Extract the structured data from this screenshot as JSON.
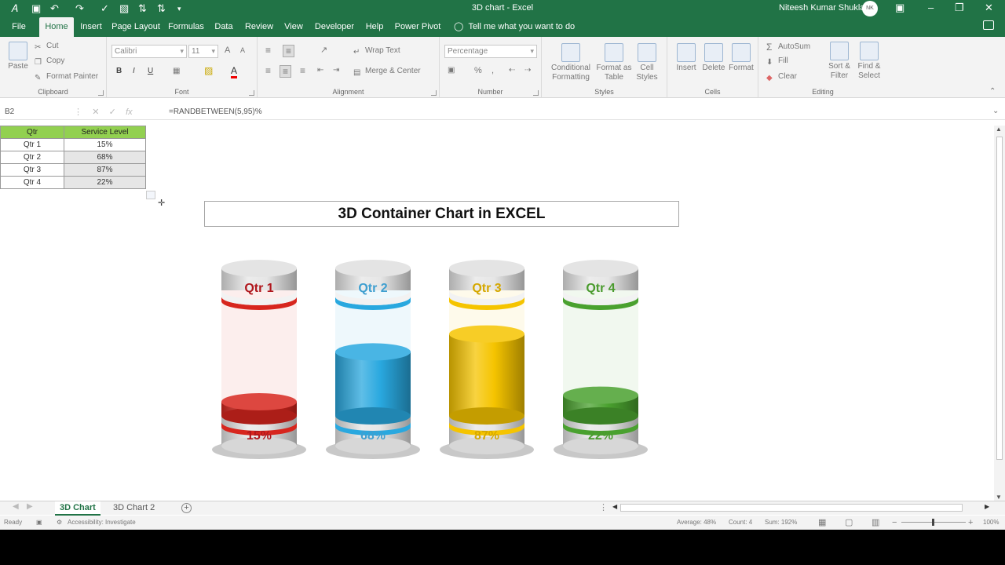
{
  "titlebar": {
    "title": "3D chart  -  Excel",
    "user": "Niteesh Kumar Shukla",
    "initials": "NK"
  },
  "tabs": [
    "File",
    "Home",
    "Insert",
    "Page Layout",
    "Formulas",
    "Data",
    "Review",
    "View",
    "Developer",
    "Help",
    "Power Pivot"
  ],
  "tell_me": "Tell me what you want to do",
  "ribbon": {
    "clipboard": {
      "paste": "Paste",
      "cut": "Cut",
      "copy": "Copy",
      "format_painter": "Format Painter",
      "name": "Clipboard"
    },
    "font": {
      "face": "Calibri",
      "size": "11",
      "bold": "B",
      "italic": "I",
      "underline": "U",
      "grow": "A",
      "shrink": "A",
      "color_a": "A",
      "name": "Font"
    },
    "alignment": {
      "wrap": "Wrap Text",
      "merge": "Merge & Center",
      "name": "Alignment"
    },
    "number": {
      "format": "Percentage",
      "percent": "%",
      "comma": ",",
      "name": "Number"
    },
    "styles": {
      "conditional": [
        "Conditional",
        "Formatting"
      ],
      "format_table": [
        "Format as",
        "Table"
      ],
      "cell_styles": [
        "Cell",
        "Styles"
      ],
      "name": "Styles"
    },
    "cells": {
      "insert": "Insert",
      "delete": "Delete",
      "format": "Format",
      "name": "Cells"
    },
    "editing": {
      "autosum": "AutoSum",
      "fill": "Fill",
      "clear": "Clear",
      "sort": [
        "Sort &",
        "Filter"
      ],
      "find": [
        "Find &",
        "Select"
      ],
      "name": "Editing"
    }
  },
  "formula_bar": {
    "name_box": "B2",
    "fx": "fx",
    "formula": "=RANDBETWEEN(5,95)%"
  },
  "table": {
    "headers": [
      "Qtr",
      "Service Level"
    ],
    "rows": [
      [
        "Qtr 1",
        "15%"
      ],
      [
        "Qtr 2",
        "68%"
      ],
      [
        "Qtr 3",
        "87%"
      ],
      [
        "Qtr 4",
        "22%"
      ]
    ]
  },
  "chart_title": "3D Container Chart in EXCEL",
  "chart_data": {
    "type": "bar",
    "categories": [
      "Qtr 1",
      "Qtr 2",
      "Qtr 3",
      "Qtr 4"
    ],
    "values": [
      15,
      68,
      87,
      22
    ],
    "value_labels": [
      "15%",
      "68%",
      "87%",
      "22%"
    ],
    "colors": [
      "#d7261e",
      "#29a8df",
      "#f5c400",
      "#4aa12f"
    ],
    "label_colors": [
      "#b0171d",
      "#3f9fd0",
      "#d5a800",
      "#4a9b2e"
    ],
    "ylim": [
      0,
      100
    ]
  },
  "sheets": {
    "tabs": [
      "3D Chart",
      "3D Chart 2"
    ],
    "active": "3D Chart",
    "add": "+"
  },
  "status": {
    "ready": "Ready",
    "accessibility": "Accessibility: Investigate",
    "average": "Average: 48%",
    "count": "Count: 4",
    "sum": "Sum: 192%",
    "zoom": "100%"
  }
}
